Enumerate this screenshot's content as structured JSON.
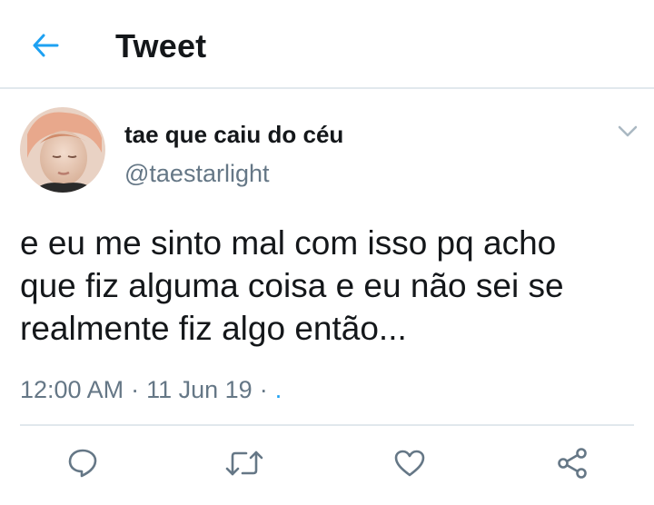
{
  "header": {
    "title": "Tweet",
    "back_icon": "arrow-left-icon",
    "accent_color": "#1da1f2"
  },
  "tweet": {
    "author": {
      "display_name": "tae que caiu do céu",
      "handle": "@taestarlight",
      "avatar_icon": "profile-photo"
    },
    "text": "e eu me sinto mal com isso pq acho\nque fiz alguma coisa e eu não sei se\nrealmente fiz algo então...",
    "time": "12:00 AM",
    "date": "11 Jun 19",
    "separator": "·",
    "app": "."
  },
  "actions": {
    "reply_icon": "reply-icon",
    "retweet_icon": "retweet-icon",
    "like_icon": "heart-icon",
    "share_icon": "share-icon",
    "icon_color": "#657786"
  }
}
